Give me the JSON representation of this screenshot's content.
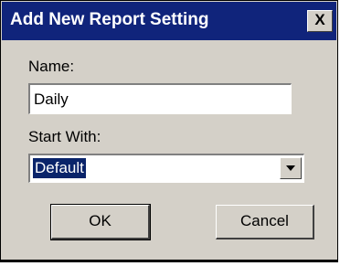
{
  "dialog": {
    "title": "Add New Report Setting",
    "close_label": "X"
  },
  "form": {
    "name_label": "Name:",
    "name_value": "Daily",
    "start_with_label": "Start With:",
    "start_with_value": "Default"
  },
  "buttons": {
    "ok_label": "OK",
    "cancel_label": "Cancel"
  },
  "colors": {
    "titlebar": "#10247b",
    "dialog_bg": "#d4d0c8",
    "selection_bg": "#0a246a"
  }
}
